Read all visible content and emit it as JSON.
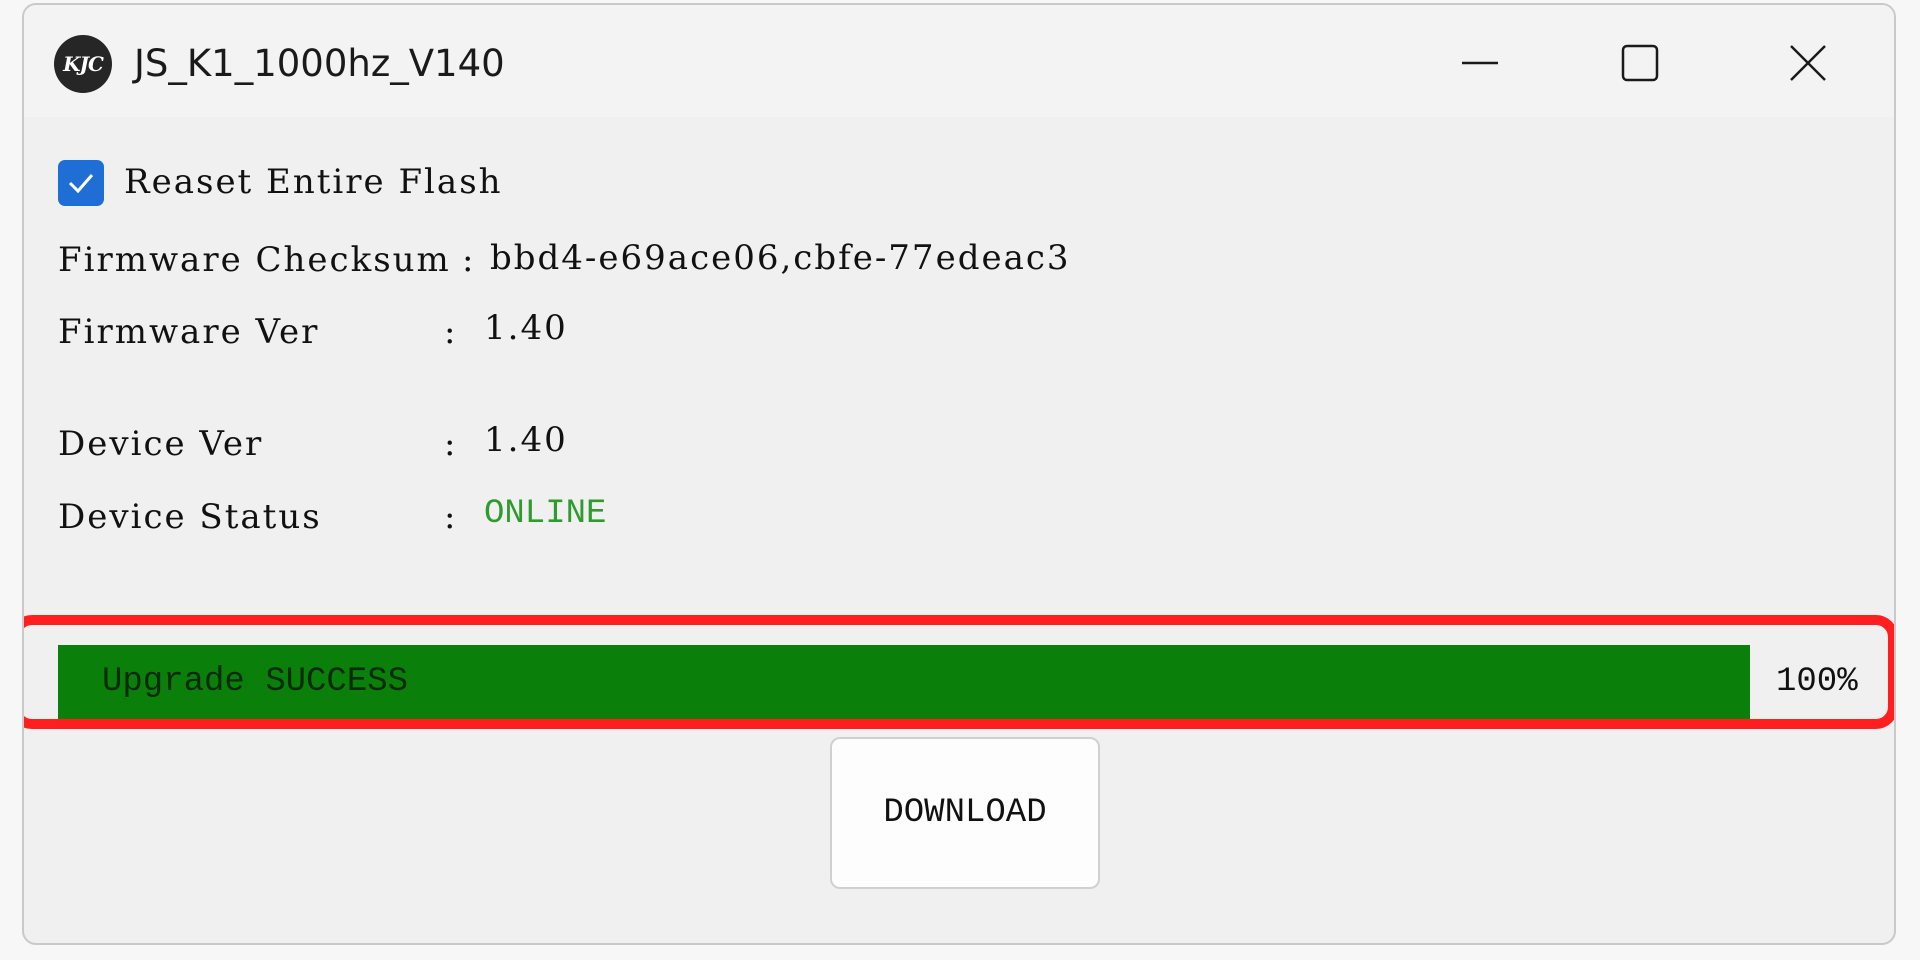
{
  "window": {
    "title": "JS_K1_1000hz_V140",
    "logo_text": "KJC"
  },
  "options": {
    "reset_flash": {
      "label": "Reaset Entire Flash",
      "checked": true
    }
  },
  "info": {
    "checksum_label": "Firmware Checksum",
    "checksum_value": "bbd4-e69ace06,cbfe-77edeac3",
    "firmware_ver_label": "Firmware Ver",
    "firmware_ver_value": "1.40",
    "device_ver_label": "Device Ver",
    "device_ver_value": "1.40",
    "device_status_label": "Device Status",
    "device_status_value": "ONLINE",
    "separator": ":"
  },
  "progress": {
    "text": "Upgrade SUCCESS",
    "percent_label": "100%",
    "value": 1.0
  },
  "actions": {
    "download_label": "DOWNLOAD"
  },
  "colors": {
    "progress_fill": "#0a7f0a",
    "status_online": "#2e9b2e",
    "checkbox": "#1e6ed6",
    "highlight": "#ff1f1f"
  },
  "icons": {
    "minimize": "minimize-icon",
    "maximize": "maximize-icon",
    "close": "close-icon",
    "checkmark": "checkmark-icon"
  }
}
